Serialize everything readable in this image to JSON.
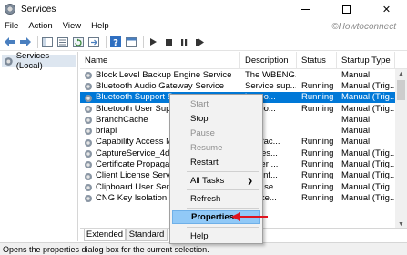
{
  "window": {
    "title": "Services",
    "watermark": "©Howtoconnect"
  },
  "menubar": [
    "File",
    "Action",
    "View",
    "Help"
  ],
  "toolbar": {
    "buttons": [
      "back-arrow-icon",
      "forward-arrow-icon",
      "console-tree-icon",
      "list-view-icon",
      "refresh-icon",
      "export-list-icon",
      "help-icon",
      "properties-icon",
      "play-icon",
      "stop-icon",
      "pause-icon",
      "restart-icon"
    ]
  },
  "tree": {
    "selected": "Services (Local)"
  },
  "columns": {
    "name": "Name",
    "description": "Description",
    "status": "Status",
    "startup": "Startup Type"
  },
  "rows": [
    {
      "name": "Block Level Backup Engine Service",
      "description": "The WBENG...",
      "status": "",
      "startup": "Manual"
    },
    {
      "name": "Bluetooth Audio Gateway Service",
      "description": "Service sup...",
      "status": "Running",
      "startup": "Manual (Trig..."
    },
    {
      "name": "Bluetooth Support Se",
      "description": "luetoo...",
      "status": "Running",
      "startup": "Manual (Trig..."
    },
    {
      "name": "Bluetooth User Suppo",
      "description": "luetoo...",
      "status": "Running",
      "startup": "Manual (Trig..."
    },
    {
      "name": "BranchCache",
      "description": "",
      "status": "",
      "startup": "Manual"
    },
    {
      "name": "brlapi",
      "description": "",
      "status": "",
      "startup": "Manual"
    },
    {
      "name": "Capability Access Ma",
      "description": "des fac...",
      "status": "Running",
      "startup": "Manual"
    },
    {
      "name": "CaptureService_4d76",
      "description": "nables...",
      "status": "Running",
      "startup": "Manual (Trig..."
    },
    {
      "name": "Certificate Propagatio",
      "description": "s user ...",
      "status": "Running",
      "startup": "Manual (Trig..."
    },
    {
      "name": "Client License Service",
      "description": "des inf...",
      "status": "Running",
      "startup": "Manual (Trig..."
    },
    {
      "name": "Clipboard User Servic",
      "description": "user se...",
      "status": "Running",
      "startup": "Manual (Trig..."
    },
    {
      "name": "CNG Key Isolation",
      "description": "NG ke...",
      "status": "Running",
      "startup": "Manual (Trig..."
    },
    {
      "name": "",
      "description": "",
      "status": "",
      "startup": ""
    }
  ],
  "selected_row_index": 2,
  "tabs": [
    "Extended",
    "Standard"
  ],
  "context_menu": {
    "start": "Start",
    "stop": "Stop",
    "pause": "Pause",
    "resume": "Resume",
    "restart": "Restart",
    "all_tasks": "All Tasks",
    "refresh": "Refresh",
    "properties": "Properties",
    "help": "Help"
  },
  "statusbar": "Opens the properties dialog box for the current selection.",
  "colors": {
    "selection": "#0078d7",
    "menu_highlight": "#91c9f7",
    "arrow": "#e0141e"
  }
}
